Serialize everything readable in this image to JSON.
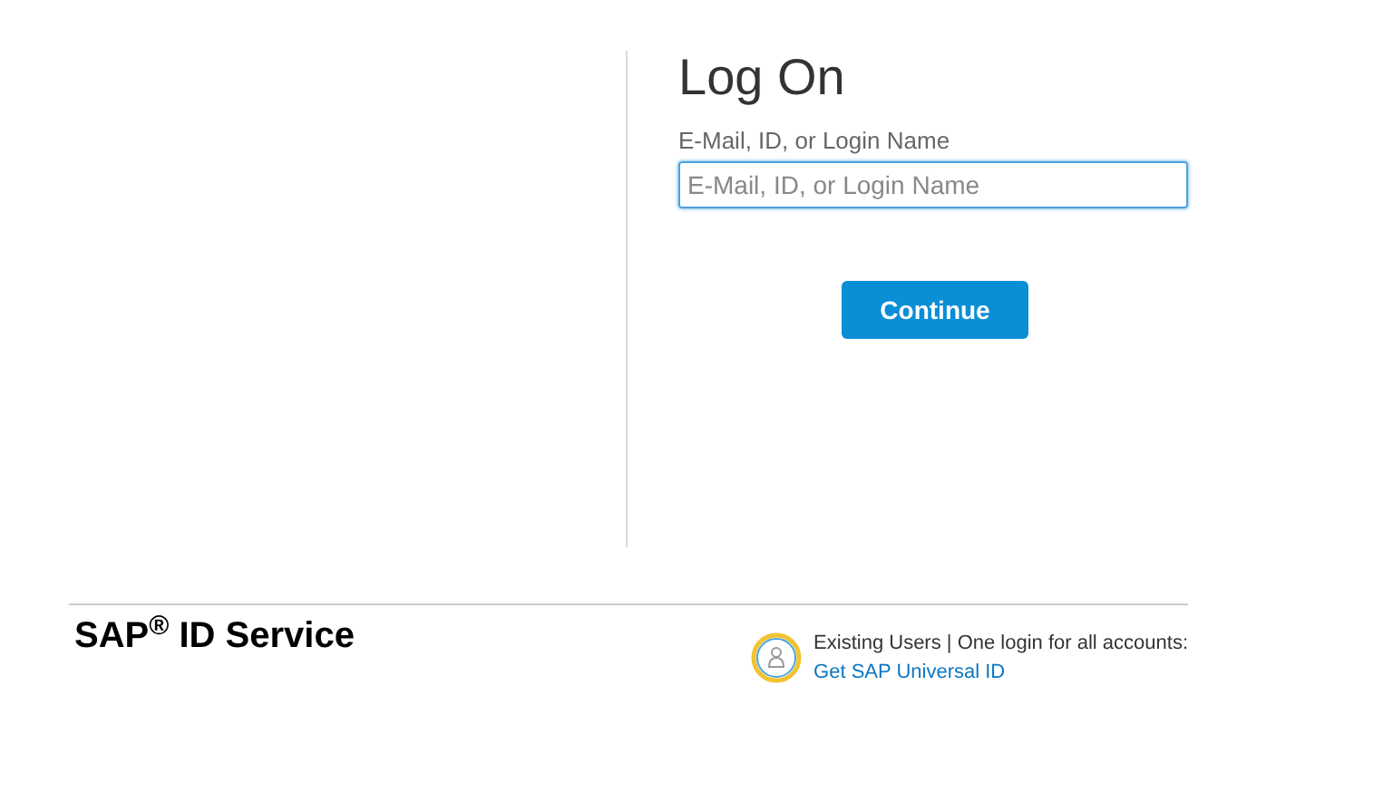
{
  "login": {
    "title": "Log On",
    "field_label": "E-Mail, ID, or Login Name",
    "field": {
      "placeholder": "E-Mail, ID, or Login Name",
      "focused": true
    },
    "button": "Continue"
  },
  "footer": {
    "brand": "SAP$^{®}$ ID Service",
    "promo_text": "Existing Users | One login for all accounts:",
    "link": "Get SAP Universal ID"
  }
}
